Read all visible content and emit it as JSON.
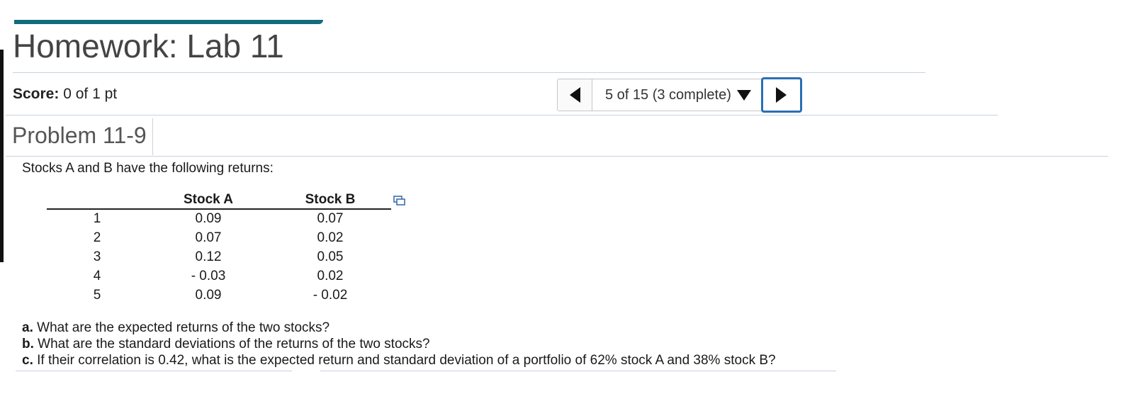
{
  "header": {
    "title": "Homework: Lab 11",
    "score_label": "Score:",
    "score_value": "0 of 1 pt"
  },
  "navigation": {
    "prev_icon": "triangle-left-icon",
    "position": "5 of 15 (3 complete)",
    "dropdown_icon": "caret-down-icon",
    "next_icon": "triangle-right-icon",
    "next_focus_color": "#2a6fb5"
  },
  "problem": {
    "title": "Problem 11-9",
    "intro": "Stocks A and B have the following returns:",
    "table": {
      "columns": [
        "",
        "Stock A",
        "Stock B"
      ],
      "rows": [
        [
          "1",
          "0.09",
          "0.07"
        ],
        [
          "2",
          "0.07",
          "0.02"
        ],
        [
          "3",
          "0.12",
          "0.05"
        ],
        [
          "4",
          "- 0.03",
          "0.02"
        ],
        [
          "5",
          "0.09",
          "- 0.02"
        ]
      ],
      "copy_icon": "copy-to-spreadsheet-icon"
    },
    "questions": [
      {
        "label": "a.",
        "text": " What are the expected returns of the two stocks?"
      },
      {
        "label": "b.",
        "text": " What are the standard deviations of the returns of the two stocks?"
      },
      {
        "label": "c.",
        "text": " If their correlation is 0.42, what is the expected return and standard deviation of a portfolio of 62% stock A and 38% stock B?"
      }
    ]
  },
  "colors": {
    "accent": "#146b7e",
    "focus": "#2a6fb5"
  }
}
